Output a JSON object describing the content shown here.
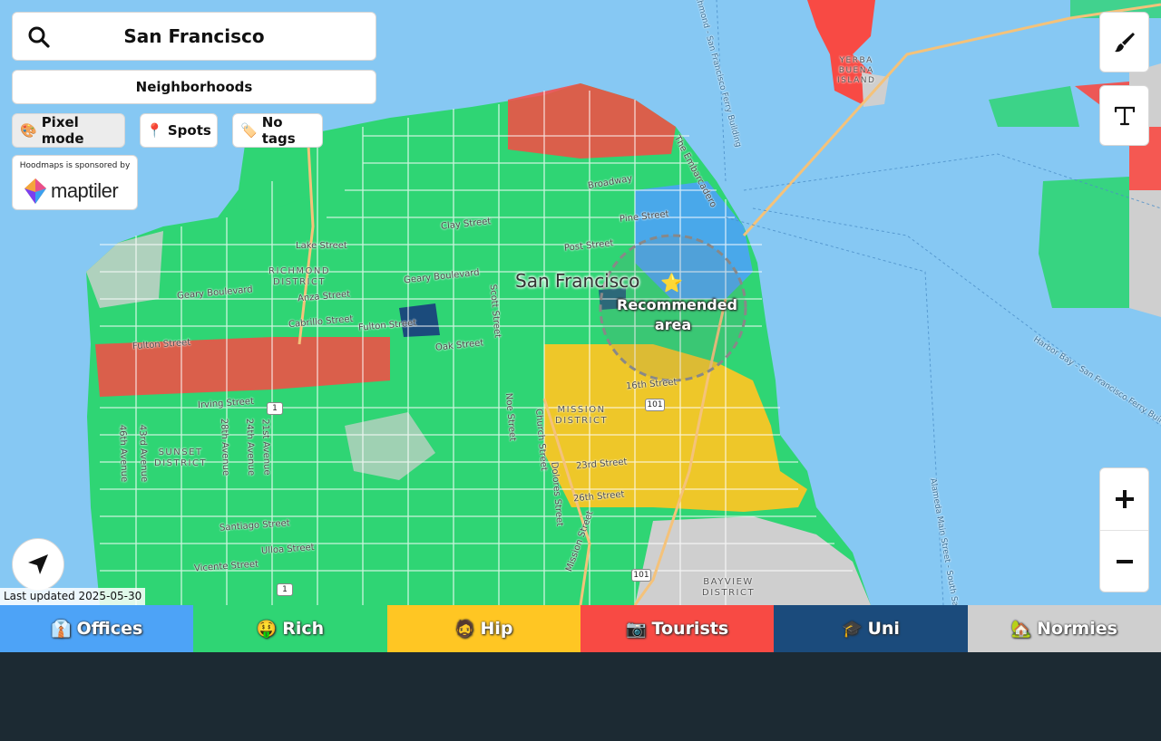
{
  "search": {
    "value": "San Francisco"
  },
  "neighborhoods_button": "Neighborhoods",
  "chips": [
    {
      "icon": "🎨",
      "label": "Pixel mode"
    },
    {
      "icon": "📍",
      "label": "Spots"
    },
    {
      "icon": "🏷️",
      "label": "No tags"
    }
  ],
  "sponsor": {
    "text": "Hoodmaps is sponsored by",
    "brand": "maptiler"
  },
  "last_updated": "Last updated 2025-05-30",
  "map": {
    "city": "San Francisco",
    "recommended": [
      "Recommended",
      "area"
    ],
    "districts": [
      {
        "id": "richmond",
        "lines": [
          "RICHMOND",
          "DISTRICT"
        ]
      },
      {
        "id": "sunset",
        "lines": [
          "SUNSET",
          "DISTRICT"
        ]
      },
      {
        "id": "mission",
        "lines": [
          "MISSION",
          "DISTRICT"
        ]
      },
      {
        "id": "bayview",
        "lines": [
          "BAYVIEW",
          "DISTRICT"
        ]
      },
      {
        "id": "yerba",
        "lines": [
          "YERBA",
          "BUENA",
          "ISLAND"
        ]
      }
    ],
    "streets": {
      "lake": "Lake Street",
      "clay": "Clay Street",
      "geary_blvd": "Geary Boulevard",
      "geary_blvd2": "Geary Boulevard",
      "anza": "Anza Street",
      "cabrillo": "Cabrillo Street",
      "fulton": "Fulton Street",
      "fulton2": "Fulton Street",
      "oak": "Oak Street",
      "post": "Post Street",
      "pine": "Pine Street",
      "broadway": "Broadway",
      "embarcadero": "The Embarcadero",
      "irving": "Irving Street",
      "santiago": "Santiago Street",
      "ulloa": "Ulloa Street",
      "vicente": "Vicente Street",
      "s16": "16th Street",
      "s23": "23rd Street",
      "s26": "26th Street",
      "noe": "Noe Street",
      "church": "Church Street",
      "dolores": "Dolores Street",
      "mission": "Mission Street",
      "scott": "Scott Street",
      "ave46": "46th Avenue",
      "ave43": "43rd Avenue",
      "ave28": "28th Avenue",
      "ave24": "24th Avenue",
      "ave21": "21st Avenue",
      "ferry1": "Richmond - San Francisco Ferry Building",
      "ferry2": "Harbor Bay - San Francisco Ferry Building",
      "ferry3": "Alameda Main Street - South Sa..."
    },
    "shields": [
      "1",
      "1",
      "101",
      "101"
    ]
  },
  "legend": [
    {
      "emoji": "👔",
      "label": "Offices",
      "color": "#4da3f7"
    },
    {
      "emoji": "🤑",
      "label": "Rich",
      "color": "#2fd574"
    },
    {
      "emoji": "🧔",
      "label": "Hip",
      "color": "#ffc623"
    },
    {
      "emoji": "📷",
      "label": "Tourists",
      "color": "#f84a44"
    },
    {
      "emoji": "🎓",
      "label": "Uni",
      "color": "#1b4b7c"
    },
    {
      "emoji": "🏡",
      "label": "Normies",
      "color": "#cfcfcf"
    }
  ],
  "colors": {
    "water": "#86c8f3",
    "rich": "#2fd574",
    "hip": "#ffc623",
    "tourists": "#f84a44",
    "offices": "#4da3f7",
    "uni": "#1b4b7c",
    "normies": "#cfcfcf"
  }
}
